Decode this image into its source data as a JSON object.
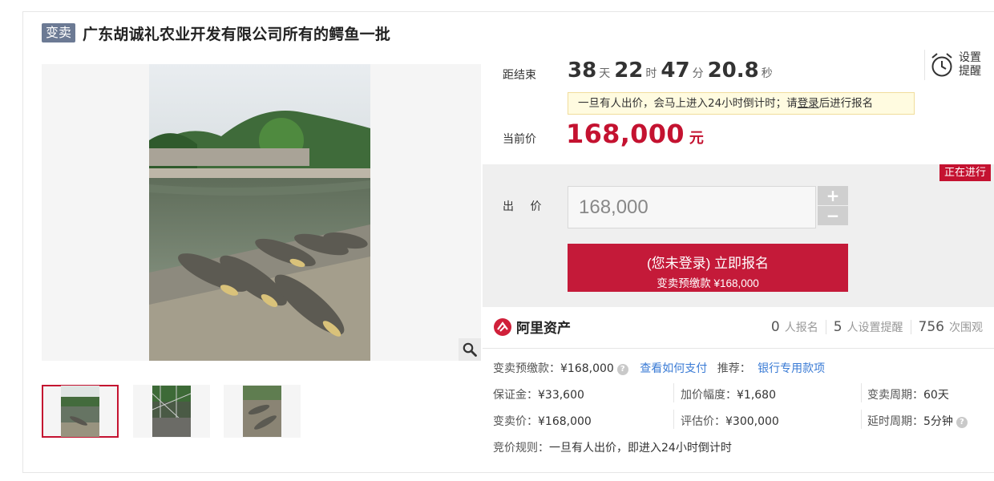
{
  "header": {
    "tag": "变卖",
    "title": "广东胡诚礼农业开发有限公司所有的鳄鱼一批"
  },
  "countdown": {
    "label": "距结束",
    "days": "38",
    "days_unit": "天",
    "hours": "22",
    "hours_unit": "时",
    "minutes": "47",
    "minutes_unit": "分",
    "seconds": "20.8",
    "seconds_unit": "秒"
  },
  "remind": {
    "label": "设置提醒",
    "icon": "alarm-clock-icon"
  },
  "notice": {
    "before": "一旦有人出价，会马上进入24小时倒计时；请",
    "link": "登录",
    "after": "后进行报名"
  },
  "price": {
    "label": "当前价",
    "value": "168,000",
    "unit": "元",
    "color": "#c41230"
  },
  "bid": {
    "status": "正在进行",
    "label": "出 价",
    "value": "168,000",
    "plus": "+",
    "minus": "−",
    "button_line1": "(您未登录) 立即报名",
    "button_line2": "变卖预缴款 ¥168,000"
  },
  "platform": {
    "name": "阿里资产",
    "signups": "0",
    "signups_unit": "人报名",
    "reminders": "5",
    "reminders_unit": "人设置提醒",
    "views": "756",
    "views_unit": "次围观"
  },
  "details": {
    "deposit_label": "变卖预缴款：",
    "deposit_value": "¥168,000",
    "how_to_pay": "查看如何支付",
    "recommend_label": "推荐：",
    "recommend_link": "银行专用款项",
    "guarantee_label": "保证金：",
    "guarantee_value": "¥33,600",
    "increment_label": "加价幅度：",
    "increment_value": "¥1,680",
    "period_label": "变卖周期：",
    "period_value": "60天",
    "sale_price_label": "变卖价：",
    "sale_price_value": "¥168,000",
    "appraisal_label": "评估价：",
    "appraisal_value": "¥300,000",
    "delay_label": "延时周期：",
    "delay_value": "5分钟",
    "rule_label": "竞价规则：",
    "rule_value": "一旦有人出价，即进入24小时倒计时"
  },
  "colors": {
    "accent": "#c41230",
    "tag_bg": "#6c7a94",
    "link": "#3a7bd5"
  }
}
